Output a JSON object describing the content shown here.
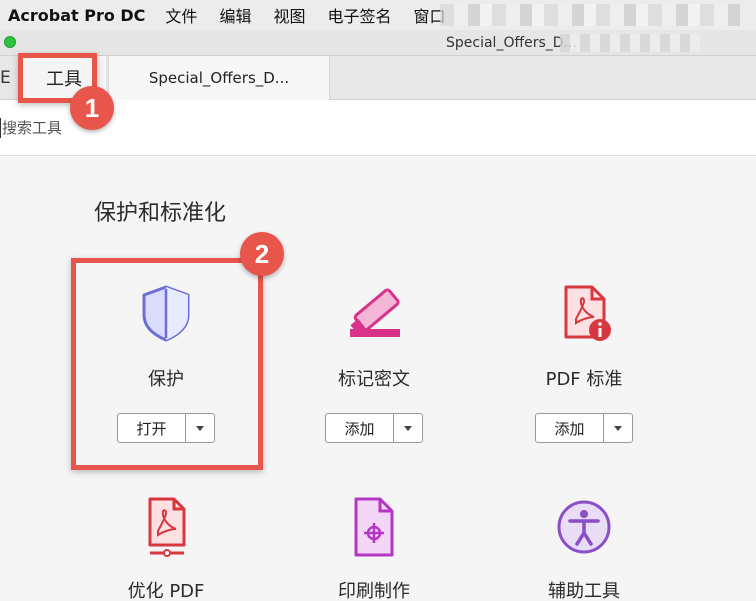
{
  "menubar": {
    "app_name": "Acrobat Pro DC",
    "items": [
      "文件",
      "编辑",
      "视图",
      "电子签名",
      "窗口"
    ]
  },
  "window": {
    "title": "Special_Offers_D..."
  },
  "tabs": {
    "home_fragment": "E",
    "tools_label": "工具",
    "doc_label": "Special_Offers_D..."
  },
  "search": {
    "placeholder": "搜索工具"
  },
  "section": {
    "title": "保护和标准化"
  },
  "tools": [
    {
      "label": "保护",
      "button": "打开",
      "icon": "shield-icon"
    },
    {
      "label": "标记密文",
      "button": "添加",
      "icon": "redact-marker-icon"
    },
    {
      "label": "PDF 标准",
      "button": "添加",
      "icon": "pdf-standard-icon"
    },
    {
      "label": "优化 PDF",
      "icon": "optimize-pdf-icon"
    },
    {
      "label": "印刷制作",
      "icon": "print-production-icon"
    },
    {
      "label": "辅助工具",
      "icon": "accessibility-icon"
    }
  ],
  "annotations": {
    "badge1": "1",
    "badge2": "2"
  },
  "colors": {
    "annotation": "#e8554a",
    "protect_icon": "#6b6fd6",
    "redact_icon": "#d9328a",
    "pdf_icon": "#d7373f",
    "print_icon": "#b437c4",
    "accessibility_icon": "#8a4fc7"
  }
}
